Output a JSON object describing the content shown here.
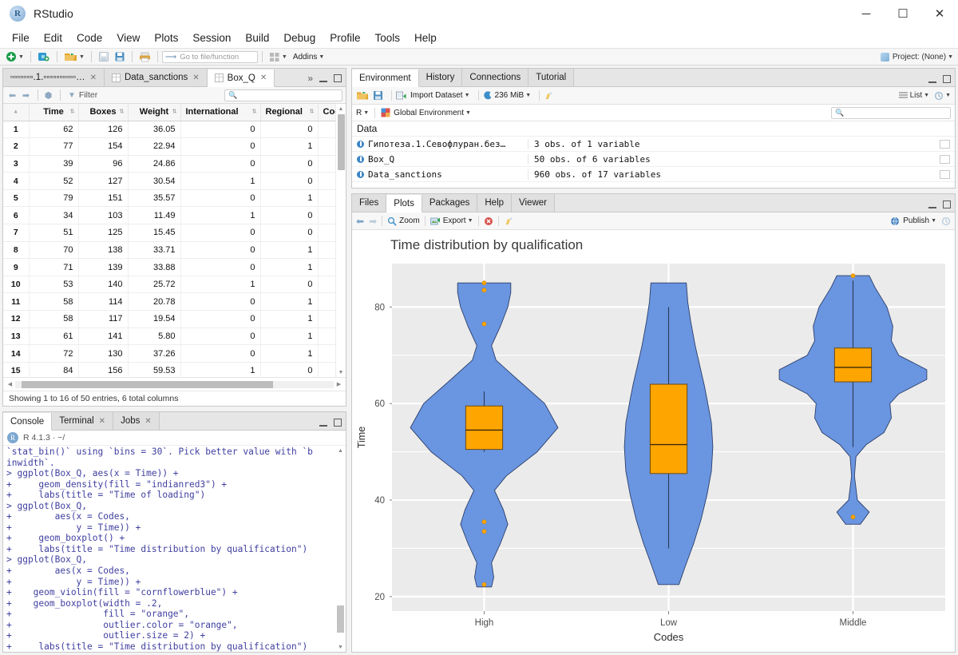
{
  "window": {
    "app_title": "RStudio",
    "logo_letter": "R",
    "minimize": "─",
    "maximize": "☐",
    "close": "✕"
  },
  "menu": {
    "items": [
      "File",
      "Edit",
      "Code",
      "View",
      "Plots",
      "Session",
      "Build",
      "Debug",
      "Profile",
      "Tools",
      "Help"
    ]
  },
  "toolbar": {
    "goto_placeholder": "Go to file/function",
    "addins_label": "Addins",
    "project_label": "Project: (None)"
  },
  "source_pane": {
    "tabs": [
      {
        "label": "▫▫▫▫▫▫▫.1.▫▫▫▫▫▫▫▫▫▫…",
        "active": false
      },
      {
        "label": "Data_sanctions",
        "active": false
      },
      {
        "label": "Box_Q",
        "active": true
      }
    ],
    "overflow_icon": "»",
    "filter_label": "Filter",
    "search_placeholder": "",
    "status": "Showing 1 to 16 of 50 entries, 6 total columns",
    "columns": [
      "Time",
      "Boxes",
      "Weight",
      "International",
      "Regional",
      "Cod"
    ],
    "rows": [
      {
        "n": "1",
        "Time": "62",
        "Boxes": "126",
        "Weight": "36.05",
        "International": "0",
        "Regional": "0"
      },
      {
        "n": "2",
        "Time": "77",
        "Boxes": "154",
        "Weight": "22.94",
        "International": "0",
        "Regional": "1"
      },
      {
        "n": "3",
        "Time": "39",
        "Boxes": "96",
        "Weight": "24.86",
        "International": "0",
        "Regional": "0"
      },
      {
        "n": "4",
        "Time": "52",
        "Boxes": "127",
        "Weight": "30.54",
        "International": "1",
        "Regional": "0"
      },
      {
        "n": "5",
        "Time": "79",
        "Boxes": "151",
        "Weight": "35.57",
        "International": "0",
        "Regional": "1"
      },
      {
        "n": "6",
        "Time": "34",
        "Boxes": "103",
        "Weight": "11.49",
        "International": "1",
        "Regional": "0"
      },
      {
        "n": "7",
        "Time": "51",
        "Boxes": "125",
        "Weight": "15.45",
        "International": "0",
        "Regional": "0"
      },
      {
        "n": "8",
        "Time": "70",
        "Boxes": "138",
        "Weight": "33.71",
        "International": "0",
        "Regional": "1"
      },
      {
        "n": "9",
        "Time": "71",
        "Boxes": "139",
        "Weight": "33.88",
        "International": "0",
        "Regional": "1"
      },
      {
        "n": "10",
        "Time": "53",
        "Boxes": "140",
        "Weight": "25.72",
        "International": "1",
        "Regional": "0"
      },
      {
        "n": "11",
        "Time": "58",
        "Boxes": "114",
        "Weight": "20.78",
        "International": "0",
        "Regional": "1"
      },
      {
        "n": "12",
        "Time": "58",
        "Boxes": "117",
        "Weight": "19.54",
        "International": "0",
        "Regional": "1"
      },
      {
        "n": "13",
        "Time": "61",
        "Boxes": "141",
        "Weight": "5.80",
        "International": "0",
        "Regional": "1"
      },
      {
        "n": "14",
        "Time": "72",
        "Boxes": "130",
        "Weight": "37.26",
        "International": "0",
        "Regional": "1"
      },
      {
        "n": "15",
        "Time": "84",
        "Boxes": "156",
        "Weight": "59.53",
        "International": "1",
        "Regional": "0"
      }
    ]
  },
  "environment_pane": {
    "tabs": [
      "Environment",
      "History",
      "Connections",
      "Tutorial"
    ],
    "active_tab": "Environment",
    "import_label": "Import Dataset",
    "memory_label": "236 MiB",
    "list_label": "List",
    "scope_r": "R",
    "scope_env": "Global Environment",
    "search_placeholder": "",
    "section_label": "Data",
    "objects": [
      {
        "name": "Гипотеза.1.Севофлуран.без…",
        "value": "3 obs. of 1 variable"
      },
      {
        "name": "Box_Q",
        "value": "50 obs. of 6 variables"
      },
      {
        "name": "Data_sanctions",
        "value": "960 obs. of 17 variables"
      }
    ]
  },
  "plot_pane": {
    "tabs": [
      "Files",
      "Plots",
      "Packages",
      "Help",
      "Viewer"
    ],
    "active_tab": "Plots",
    "zoom_label": "Zoom",
    "export_label": "Export",
    "publish_label": "Publish"
  },
  "console_pane": {
    "tabs": [
      "Console",
      "Terminal",
      "Jobs"
    ],
    "active_tab": "Console",
    "version": "R 4.1.3 · ~/",
    "text": "`stat_bin()` using `bins = 30`. Pick better value with `b\ninwidth`.\n> ggplot(Box_Q, aes(x = Time)) +\n+     geom_density(fill = \"indianred3\") +\n+     labs(title = \"Time of loading\")\n> ggplot(Box_Q,\n+        aes(x = Codes,\n+            y = Time)) +\n+     geom_boxplot() +\n+     labs(title = \"Time distribution by qualification\")\n> ggplot(Box_Q,\n+        aes(x = Codes,\n+            y = Time)) +\n+    geom_violin(fill = \"cornflowerblue\") +\n+    geom_boxplot(width = .2,\n+                 fill = \"orange\",\n+                 outlier.color = \"orange\",\n+                 outlier.size = 2) +\n+     labs(title = \"Time distribution by qualification\")"
  },
  "chart_data": {
    "type": "violin",
    "title": "Time distribution by qualification",
    "xlabel": "Codes",
    "ylabel": "Time",
    "categories": [
      "High",
      "Low",
      "Middle"
    ],
    "yticks": [
      20,
      40,
      60,
      80
    ],
    "ylim": [
      17,
      89
    ],
    "grid": true,
    "legend": false,
    "panel_bg": "#ebebeb",
    "grid_color": "#ffffff",
    "violin_fill": "#6a95e0",
    "box_fill": "#ffa500",
    "outlier_color": "#ffa500",
    "series": [
      {
        "name": "High",
        "box": {
          "lower_whisker": 50.0,
          "q1": 50.5,
          "median": 54.5,
          "q3": 59.5,
          "upper_whisker": 62.5
        },
        "outliers": [
          85.0,
          83.5,
          76.5,
          35.5,
          33.5,
          22.5
        ],
        "violin_min": 22.0,
        "violin_max": 85.0,
        "density_profile": [
          {
            "y": 22.0,
            "w": 0.1
          },
          {
            "y": 24.0,
            "w": 0.13
          },
          {
            "y": 27.0,
            "w": 0.1
          },
          {
            "y": 31.0,
            "w": 0.22
          },
          {
            "y": 35.0,
            "w": 0.32
          },
          {
            "y": 38.0,
            "w": 0.26
          },
          {
            "y": 42.0,
            "w": 0.14
          },
          {
            "y": 45.0,
            "w": 0.3
          },
          {
            "y": 50.0,
            "w": 0.72
          },
          {
            "y": 55.0,
            "w": 1.0
          },
          {
            "y": 60.0,
            "w": 0.82
          },
          {
            "y": 65.0,
            "w": 0.45
          },
          {
            "y": 69.0,
            "w": 0.16
          },
          {
            "y": 72.0,
            "w": 0.1
          },
          {
            "y": 76.0,
            "w": 0.22
          },
          {
            "y": 80.0,
            "w": 0.32
          },
          {
            "y": 83.0,
            "w": 0.36
          },
          {
            "y": 85.0,
            "w": 0.36
          }
        ]
      },
      {
        "name": "Low",
        "box": {
          "lower_whisker": 30.0,
          "q1": 45.5,
          "median": 51.5,
          "q3": 64.0,
          "upper_whisker": 80.0
        },
        "outliers": [],
        "violin_min": 22.5,
        "violin_max": 85.0,
        "density_profile": [
          {
            "y": 22.5,
            "w": 0.14
          },
          {
            "y": 26.0,
            "w": 0.22
          },
          {
            "y": 31.0,
            "w": 0.34
          },
          {
            "y": 36.0,
            "w": 0.44
          },
          {
            "y": 41.0,
            "w": 0.52
          },
          {
            "y": 46.0,
            "w": 0.58
          },
          {
            "y": 51.0,
            "w": 0.6
          },
          {
            "y": 56.0,
            "w": 0.58
          },
          {
            "y": 61.0,
            "w": 0.52
          },
          {
            "y": 64.0,
            "w": 0.48
          },
          {
            "y": 68.0,
            "w": 0.42
          },
          {
            "y": 72.0,
            "w": 0.36
          },
          {
            "y": 77.0,
            "w": 0.3
          },
          {
            "y": 81.0,
            "w": 0.26
          },
          {
            "y": 85.0,
            "w": 0.24
          }
        ]
      },
      {
        "name": "Middle",
        "box": {
          "lower_whisker": 51.0,
          "q1": 64.5,
          "median": 67.5,
          "q3": 71.5,
          "upper_whisker": 85.5
        },
        "outliers": [
          86.5,
          36.5
        ],
        "violin_min": 35.0,
        "violin_max": 86.5,
        "density_profile": [
          {
            "y": 35.0,
            "w": 0.1
          },
          {
            "y": 37.5,
            "w": 0.22
          },
          {
            "y": 40.0,
            "w": 0.06
          },
          {
            "y": 45.0,
            "w": 0.02
          },
          {
            "y": 49.0,
            "w": 0.04
          },
          {
            "y": 51.5,
            "w": 0.18
          },
          {
            "y": 54.0,
            "w": 0.42
          },
          {
            "y": 57.0,
            "w": 0.52
          },
          {
            "y": 60.0,
            "w": 0.5
          },
          {
            "y": 62.0,
            "w": 0.62
          },
          {
            "y": 65.0,
            "w": 1.0
          },
          {
            "y": 67.0,
            "w": 1.0
          },
          {
            "y": 70.0,
            "w": 0.62
          },
          {
            "y": 73.0,
            "w": 0.52
          },
          {
            "y": 76.0,
            "w": 0.54
          },
          {
            "y": 80.0,
            "w": 0.46
          },
          {
            "y": 84.0,
            "w": 0.3
          },
          {
            "y": 86.5,
            "w": 0.22
          }
        ]
      }
    ]
  }
}
